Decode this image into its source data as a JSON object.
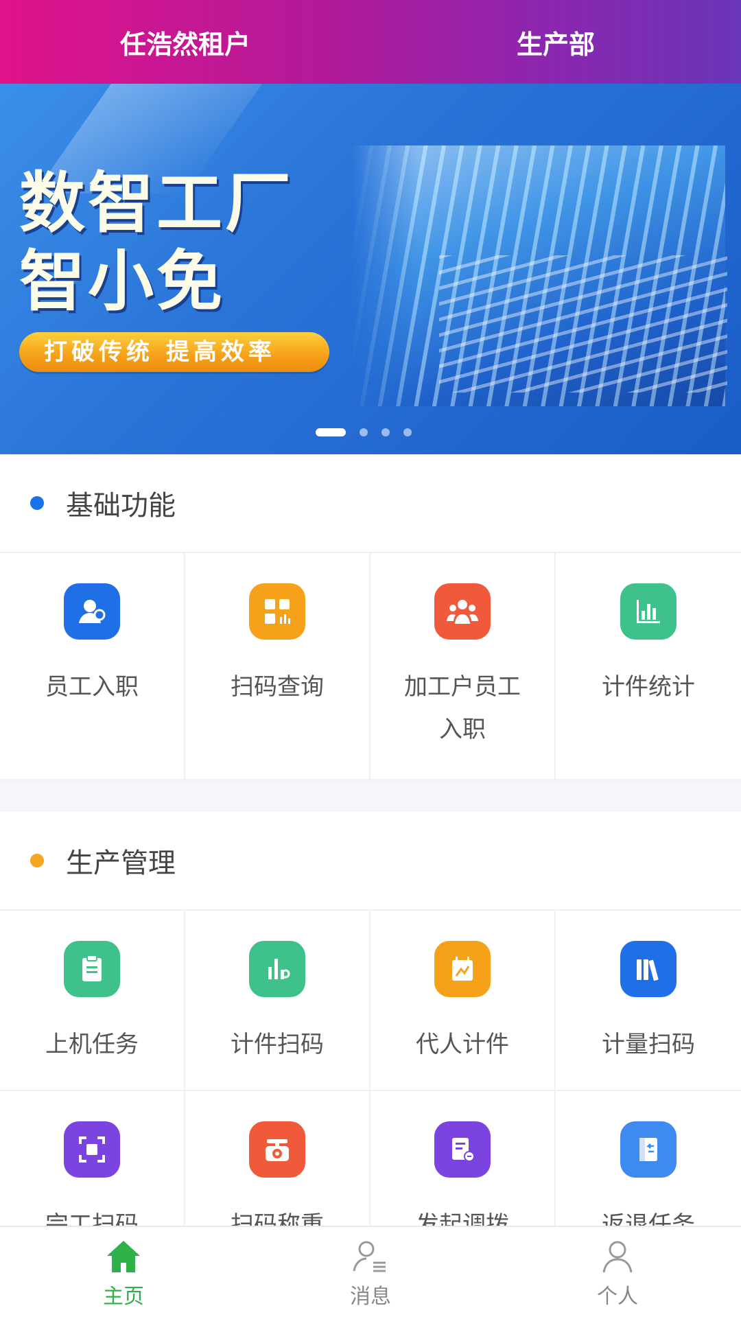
{
  "header": {
    "left": "任浩然租户",
    "right": "生产部"
  },
  "banner": {
    "line1": "数智工厂",
    "line2": "智小免",
    "slogan": "打破传统 提高效率",
    "dots": 4,
    "active_dot": 0
  },
  "basic": {
    "title": "基础功能",
    "bullet_color": "#1a73e8",
    "items": [
      {
        "label": "员工入职",
        "icon": "user-onboard-icon",
        "color": "#1f6fe6"
      },
      {
        "label": "扫码查询",
        "icon": "grid-scan-icon",
        "color": "#f5a11a"
      },
      {
        "label": "加工户员工入职",
        "icon": "group-users-icon",
        "color": "#f0593a"
      },
      {
        "label": "计件统计",
        "icon": "bar-chart-icon",
        "color": "#3ec18a"
      }
    ]
  },
  "production": {
    "title": "生产管理",
    "bullet_color": "#f5a623",
    "items": [
      {
        "label": "上机任务",
        "icon": "clipboard-icon",
        "color": "#3ec18a"
      },
      {
        "label": "计件扫码",
        "icon": "chart-scan-icon",
        "color": "#3ec18a"
      },
      {
        "label": "代人计件",
        "icon": "calendar-chart-icon",
        "color": "#f5a11a"
      },
      {
        "label": "计量扫码",
        "icon": "books-icon",
        "color": "#1f6fe6"
      },
      {
        "label": "完工扫码",
        "icon": "frame-scan-icon",
        "color": "#7b43e0"
      },
      {
        "label": "扫码称重",
        "icon": "scale-icon",
        "color": "#f0593a"
      },
      {
        "label": "发起调拨",
        "icon": "transfer-doc-icon",
        "color": "#7b43e0"
      },
      {
        "label": "返退任务",
        "icon": "return-door-icon",
        "color": "#3d8af0"
      }
    ]
  },
  "tabbar": {
    "items": [
      {
        "label": "主页",
        "icon": "home-icon",
        "active": true
      },
      {
        "label": "消息",
        "icon": "message-user-icon",
        "active": false
      },
      {
        "label": "个人",
        "icon": "person-icon",
        "active": false
      }
    ],
    "active_color": "#2fb14a"
  }
}
